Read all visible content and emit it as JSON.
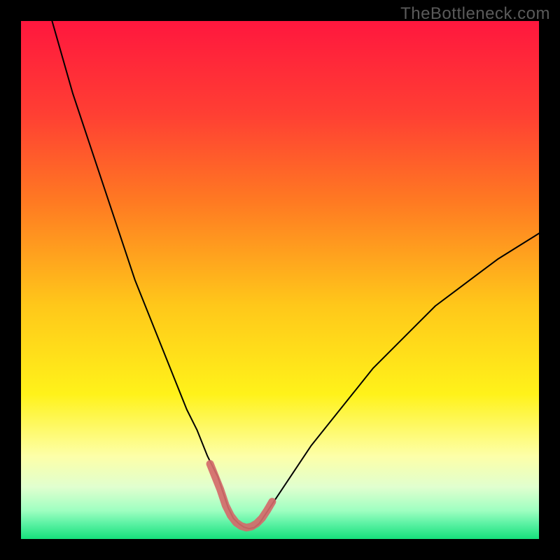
{
  "watermark": "TheBottleneck.com",
  "chart_data": {
    "type": "line",
    "title": "",
    "xlabel": "",
    "ylabel": "",
    "xlim": [
      0,
      100
    ],
    "ylim": [
      0,
      100
    ],
    "background": {
      "type": "vertical-gradient",
      "stops": [
        {
          "offset": 0.0,
          "color": "#ff173e"
        },
        {
          "offset": 0.18,
          "color": "#ff3f33"
        },
        {
          "offset": 0.35,
          "color": "#ff7a22"
        },
        {
          "offset": 0.55,
          "color": "#ffc81a"
        },
        {
          "offset": 0.72,
          "color": "#fff21a"
        },
        {
          "offset": 0.84,
          "color": "#fdffa8"
        },
        {
          "offset": 0.9,
          "color": "#e0ffcf"
        },
        {
          "offset": 0.945,
          "color": "#9fffc1"
        },
        {
          "offset": 0.97,
          "color": "#5cf2a4"
        },
        {
          "offset": 1.0,
          "color": "#16e07c"
        }
      ]
    },
    "series": [
      {
        "name": "bottleneck-curve",
        "stroke": "#000000",
        "stroke_width": 2,
        "x": [
          6,
          8,
          10,
          12,
          14,
          16,
          18,
          20,
          22,
          24,
          26,
          28,
          30,
          32,
          34,
          36,
          37,
          38,
          39,
          40,
          41,
          42,
          43,
          44,
          45,
          46,
          48,
          52,
          56,
          60,
          64,
          68,
          72,
          76,
          80,
          84,
          88,
          92,
          96,
          100
        ],
        "y": [
          100,
          93,
          86,
          80,
          74,
          68,
          62,
          56,
          50,
          45,
          40,
          35,
          30,
          25,
          21,
          16,
          14,
          12,
          9,
          6,
          4,
          3,
          2.3,
          2,
          2.2,
          3,
          6,
          12,
          18,
          23,
          28,
          33,
          37,
          41,
          45,
          48,
          51,
          54,
          56.5,
          59
        ]
      },
      {
        "name": "sweet-spot-overlay",
        "stroke": "#d46a6a",
        "stroke_width": 11,
        "linecap": "round",
        "x": [
          36.5,
          37.5,
          38.5,
          39.5,
          40.5,
          41.5,
          42.5,
          43.5,
          44.5,
          45.5,
          46.5,
          47.5,
          48.5
        ],
        "y": [
          14.5,
          12,
          9.5,
          6.5,
          4.5,
          3.2,
          2.5,
          2.2,
          2.4,
          3,
          4,
          5.5,
          7.2
        ]
      }
    ]
  }
}
